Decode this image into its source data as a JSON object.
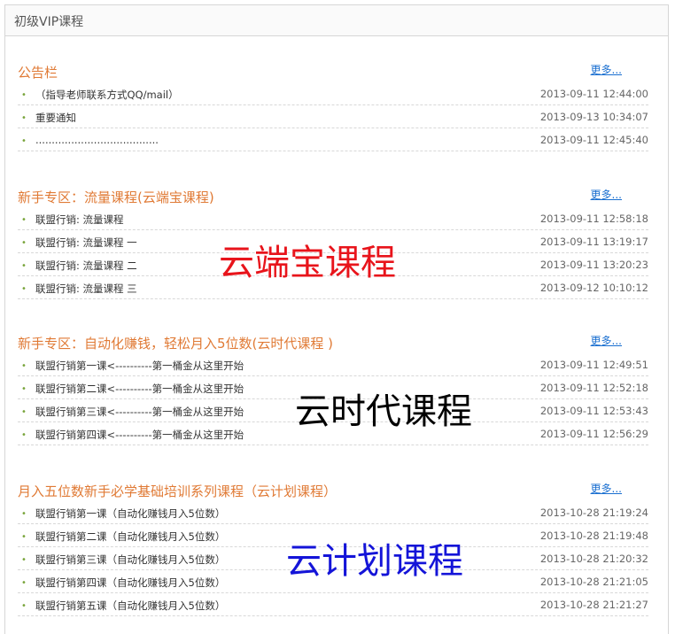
{
  "panel": {
    "title": "初级VIP课程"
  },
  "sections": [
    {
      "title": "公告栏",
      "more": "更多...",
      "items": [
        {
          "text": "（指导老师联系方式QQ/mail）",
          "date": "2013-09-11 12:44:00"
        },
        {
          "text": "重要通知",
          "date": "2013-09-13 10:34:07"
        },
        {
          "text": "......................................",
          "date": "2013-09-11 12:45:40"
        }
      ]
    },
    {
      "title": "新手专区：流量课程(云端宝课程)",
      "more": "更多...",
      "items": [
        {
          "text": "联盟行销: 流量课程",
          "date": "2013-09-11 12:58:18"
        },
        {
          "text": "联盟行销: 流量课程 一",
          "date": "2013-09-11 13:19:17"
        },
        {
          "text": "联盟行销: 流量课程 二",
          "date": "2013-09-11 13:20:23"
        },
        {
          "text": "联盟行销: 流量课程 三",
          "date": "2013-09-12 10:10:12"
        }
      ]
    },
    {
      "title": "新手专区：自动化赚钱，轻松月入5位数(云时代课程 )",
      "more": "更多...",
      "items": [
        {
          "text": "联盟行销第一课<----------第一桶金从这里开始",
          "date": "2013-09-11 12:49:51"
        },
        {
          "text": "联盟行销第二课<----------第一桶金从这里开始",
          "date": "2013-09-11 12:52:18"
        },
        {
          "text": "联盟行销第三课<----------第一桶金从这里开始",
          "date": "2013-09-11 12:53:43"
        },
        {
          "text": "联盟行销第四课<----------第一桶金从这里开始",
          "date": "2013-09-11 12:56:29"
        }
      ]
    },
    {
      "title": "月入五位数新手必学基础培训系列课程（云计划课程）",
      "more": "更多...",
      "items": [
        {
          "text": "联盟行销第一课（自动化赚钱月入5位数）",
          "date": "2013-10-28 21:19:24"
        },
        {
          "text": "联盟行销第二课（自动化赚钱月入5位数）",
          "date": "2013-10-28 21:19:48"
        },
        {
          "text": "联盟行销第三课（自动化赚钱月入5位数）",
          "date": "2013-10-28 21:20:32"
        },
        {
          "text": "联盟行销第四课（自动化赚钱月入5位数）",
          "date": "2013-10-28 21:21:05"
        },
        {
          "text": "联盟行销第五课（自动化赚钱月入5位数）",
          "date": "2013-10-28 21:21:27"
        }
      ]
    }
  ],
  "overlays": [
    {
      "text": "云端宝课程",
      "color": "#e8141b"
    },
    {
      "text": "云时代课程",
      "color": "#000000"
    },
    {
      "text": "云计划课程",
      "color": "#1414d8"
    }
  ]
}
